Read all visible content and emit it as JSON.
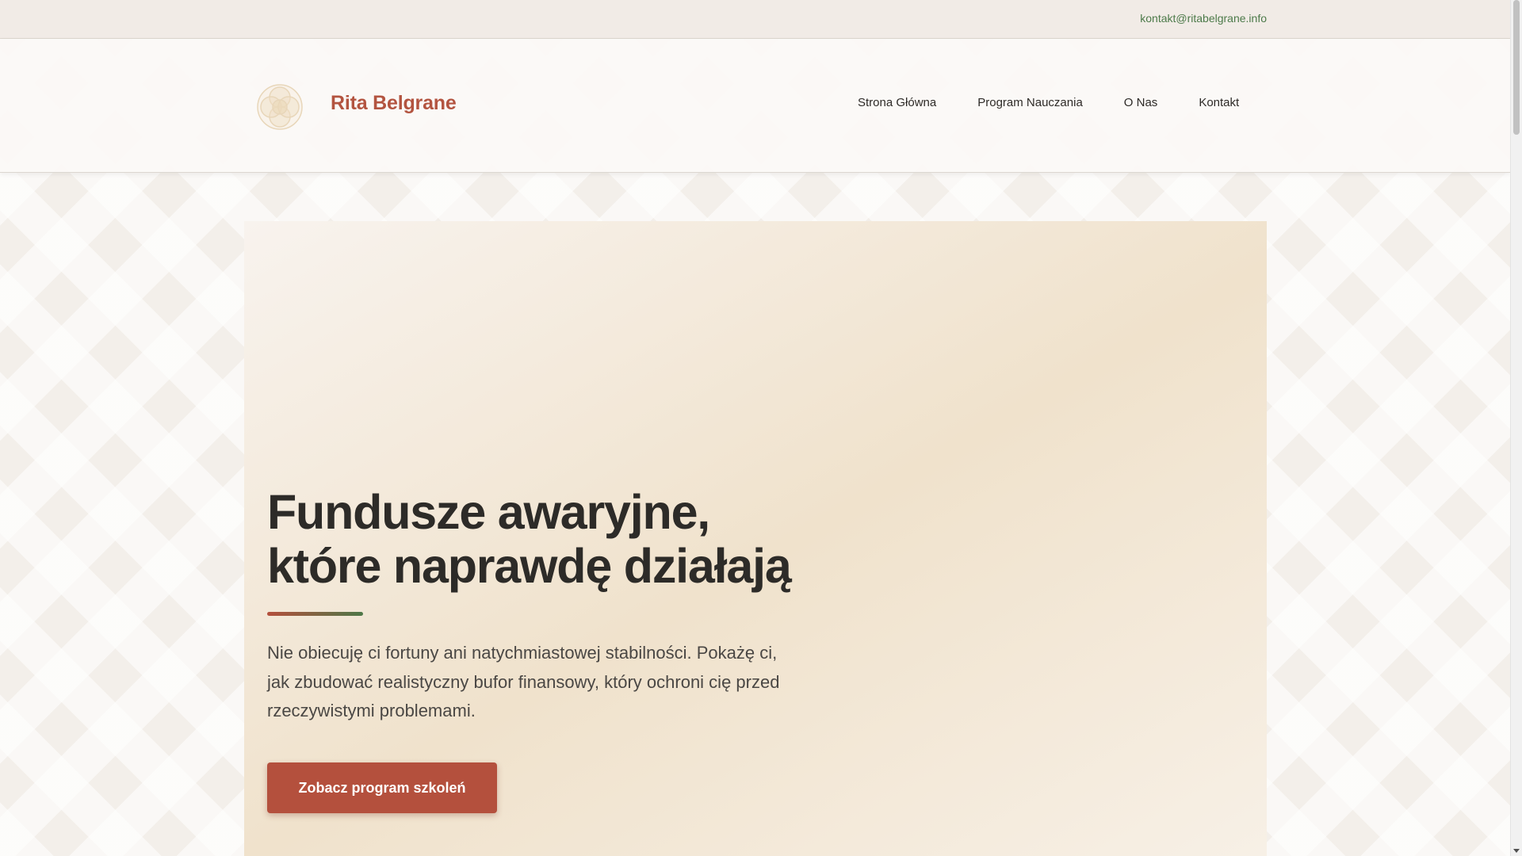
{
  "topbar": {
    "email": "kontakt@ritabelgrane.info"
  },
  "header": {
    "logo_icon": "flower-logo-icon",
    "brand": "Rita Belgrane",
    "nav": [
      {
        "label": "Strona Główna"
      },
      {
        "label": "Program Nauczania"
      },
      {
        "label": "O Nas"
      },
      {
        "label": "Kontakt"
      }
    ]
  },
  "hero": {
    "title_line1": "Fundusze awaryjne,",
    "title_line2": "które naprawdę działają",
    "lead": "Nie obiecuję ci fortuny ani natychmiastowej stabilności. Pokażę ci, jak zbudować realistyczny bufor finansowy, który ochroni cię przed rzeczywistymi problemami.",
    "cta_label": "Zobacz program szkoleń"
  },
  "colors": {
    "brand": "#b4503d",
    "accent_green": "#4e7848",
    "text_dark": "#2d2b28"
  }
}
